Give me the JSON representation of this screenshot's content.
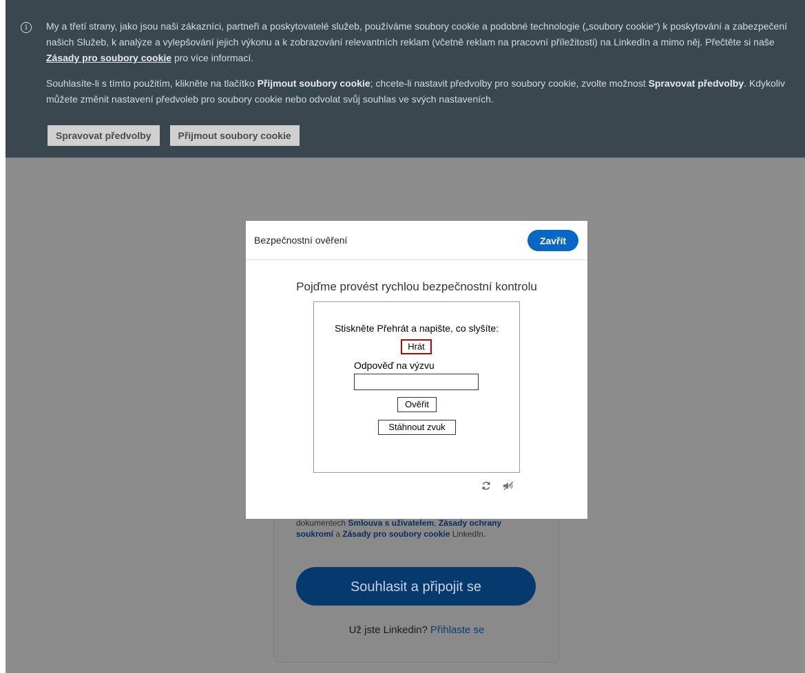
{
  "cookie_banner": {
    "paragraph1_part1": "My a třetí strany, jako jsou naši zákazníci, partneři a poskytovatelé služeb, používáme soubory cookie a podobné technologie („soubory cookie“) k poskytování a zabezpečení našich Služeb, k analýze a vylepšování jejich výkonu a k zobrazování relevantních reklam (včetně reklam na pracovní příležitosti) na LinkedIn a mimo něj. Přečtěte si naše ",
    "cookie_policy_link": "Zásady pro soubory cookie",
    "paragraph1_part2": " pro více informací.",
    "paragraph2_part1": "Souhlasíte-li s tímto použitím, klikněte na tlačítko ",
    "accept_bold": "Přijmout soubory cookie",
    "paragraph2_part2": "; chcete-li nastavit předvolby pro soubory cookie, zvolte možnost ",
    "manage_bold": "Spravovat předvolby",
    "paragraph2_part3": ". Kdykoliv můžete změnit nastavení předvoleb pro soubory cookie nebo odvolat svůj souhlas ve svých nastaveních.",
    "manage_button": "Spravovat předvolby",
    "accept_button": "Přijmout soubory cookie",
    "info_icon": "info-icon"
  },
  "modal": {
    "title": "Bezpečnostní ověření",
    "close_button": "Zavřít",
    "heading": "Pojďme provést rychlou bezpečnostní kontrolu",
    "captcha": {
      "instructions": "Stiskněte Přehrát a napište, co slyšíte:",
      "play_button": "Hrát",
      "answer_label": "Odpověď na výzvu",
      "answer_value": "",
      "verify_button": "Ověřit",
      "download_button": "Stáhnout zvuk"
    },
    "icons": [
      "refresh-icon",
      "audio-off-icon"
    ]
  },
  "signup_card": {
    "terms_prefix": "dokumentech ",
    "user_agreement": "Smlouva s uživatelem",
    "comma": ", ",
    "privacy_policy": "Zásady ochrany soukromí",
    "and": " a ",
    "cookie_policy": "Zásady pro soubory cookie",
    "suffix": " LinkedIn.",
    "agree_button": "Souhlasit a připojit se",
    "signin_prompt": "Už jste Linkedin? ",
    "signin_link": "Přihlaste se"
  },
  "colors": {
    "banner_bg": "#39474f",
    "overlay_bg": "#8c8c8c",
    "brand_blue": "#0a66c2",
    "play_border": "#c00000"
  }
}
